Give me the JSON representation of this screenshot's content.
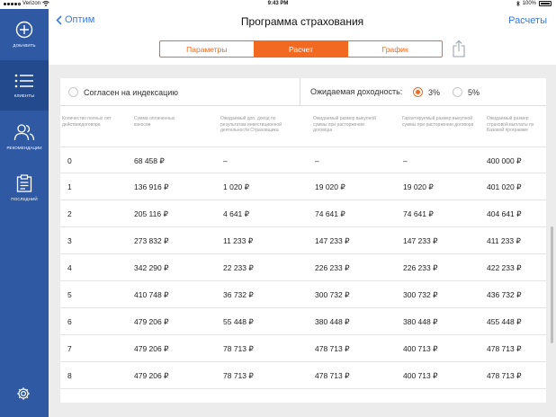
{
  "statusbar": {
    "carrier": "Verizon",
    "time": "9:43 PM",
    "battery": "100%"
  },
  "sidebar": {
    "items": [
      {
        "label": "ДОБАВИТЬ",
        "icon": "plus-circle-icon"
      },
      {
        "label": "КЛИЕНТЫ",
        "icon": "list-icon"
      },
      {
        "label": "РЕКОМЕНДАЦИИ",
        "icon": "people-icon"
      },
      {
        "label": "ПОСЛЕДНИЙ",
        "icon": "clipboard-icon"
      }
    ],
    "settings_icon": "gear-icon",
    "colors": {
      "bg": "#2f5aa3",
      "active": "#234a8c"
    }
  },
  "header": {
    "back_label": "Оптим",
    "title": "Программа страхования",
    "action_label": "Расчеты",
    "tabs": [
      "Параметры",
      "Расчет",
      "График"
    ],
    "active_tab": 1,
    "share_icon": "share-icon",
    "accent": "#f26a21",
    "link_color": "#3a7be0"
  },
  "options": {
    "indexation_label": "Согласен на индексацию",
    "indexation_checked": false,
    "yield_label": "Ожидаемая доходность:",
    "yield_options": [
      "3%",
      "5%"
    ],
    "yield_selected": 0
  },
  "table": {
    "columns": [
      "Количество полных лет действиедоговора",
      "Сумма оплаченных взносов",
      "Ожидаемый доп. доход по результатам инвестиционной деятельности Страховщика",
      "Ожидаемый размер выкупной суммы при расторжении договора",
      "Гарантируемый размер выкупной суммы при расторжении договора",
      "Ожидаемый размер страховой выплаты по Базовой программе"
    ],
    "rows": [
      [
        "0",
        "68 458 ₽",
        "–",
        "–",
        "–",
        "400 000 ₽"
      ],
      [
        "1",
        "136 916 ₽",
        "1 020 ₽",
        "19 020 ₽",
        "19 020 ₽",
        "401 020 ₽"
      ],
      [
        "2",
        "205 116 ₽",
        "4 641 ₽",
        "74 641 ₽",
        "74 641 ₽",
        "404 641 ₽"
      ],
      [
        "3",
        "273 832 ₽",
        "11 233 ₽",
        "147 233 ₽",
        "147 233 ₽",
        "411 233 ₽"
      ],
      [
        "4",
        "342 290 ₽",
        "22 233 ₽",
        "226 233 ₽",
        "226 233 ₽",
        "422 233 ₽"
      ],
      [
        "5",
        "410 748 ₽",
        "36 732 ₽",
        "300 732 ₽",
        "300 732 ₽",
        "436 732 ₽"
      ],
      [
        "6",
        "479 206 ₽",
        "55 448 ₽",
        "380 448 ₽",
        "380 448 ₽",
        "455 448 ₽"
      ],
      [
        "7",
        "479 206 ₽",
        "78 713 ₽",
        "478 713 ₽",
        "400 713 ₽",
        "478 713 ₽"
      ],
      [
        "8",
        "479 206 ₽",
        "78 713 ₽",
        "478 713 ₽",
        "400 713 ₽",
        "478 713 ₽"
      ]
    ]
  }
}
